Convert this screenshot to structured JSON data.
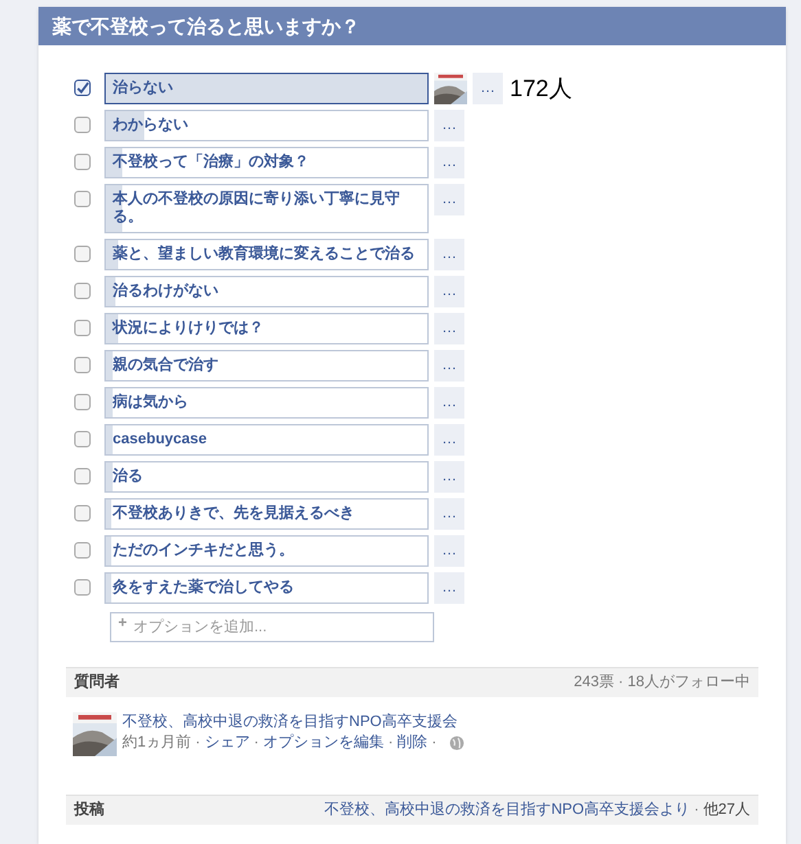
{
  "dialog": {
    "title": "薬で不登校って治ると思いますか？"
  },
  "options": [
    {
      "label": "治らない",
      "checked": true,
      "level": 1,
      "voters": true,
      "count": "172人"
    },
    {
      "label": "わからない",
      "checked": false,
      "level": 0.12
    },
    {
      "label": "不登校って「治療」の対象？",
      "checked": false,
      "level": 0.05
    },
    {
      "label": "本人の不登校の原因に寄り添い丁寧に見守る。",
      "checked": false,
      "level": 0.05
    },
    {
      "label": "薬と、望ましい教育環境に変えることで治る",
      "checked": false,
      "level": 0.04
    },
    {
      "label": "治るわけがない",
      "checked": false,
      "level": 0.03
    },
    {
      "label": "状況によりけりでは？",
      "checked": false,
      "level": 0.04
    },
    {
      "label": "親の気合で治す",
      "checked": false,
      "level": 0.02
    },
    {
      "label": "病は気から",
      "checked": false,
      "level": 0.02
    },
    {
      "label": "casebuycase",
      "checked": false,
      "level": 0.02
    },
    {
      "label": "治る",
      "checked": false,
      "level": 0.02
    },
    {
      "label": "不登校ありきで、先を見据えるべき",
      "checked": false,
      "level": 0.01
    },
    {
      "label": "ただのインチキだと思う。",
      "checked": false,
      "level": 0.01
    },
    {
      "label": "灸をすえた薬で治してやる",
      "checked": false,
      "level": 0.01
    }
  ],
  "more_label": "…",
  "add_option": {
    "icon": "+",
    "placeholder": "オプションを追加..."
  },
  "asker": {
    "heading": "質問者",
    "stats": "243票 · 18人がフォロー中",
    "name": "不登校、高校中退の救済を目指すNPO高卒支援会",
    "time": "約1ヵ月前",
    "sep": "·",
    "actions": [
      "シェア",
      "オプションを編集",
      "削除"
    ]
  },
  "posts": {
    "heading": "投稿",
    "source": "不登校、高校中退の救済を目指すNPO高卒支援会より",
    "others": "他27人"
  }
}
